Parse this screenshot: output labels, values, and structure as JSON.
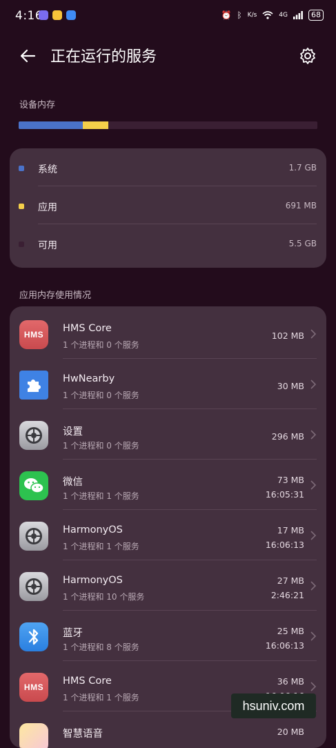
{
  "status_bar": {
    "time": "4:16",
    "net_speed": "K/s",
    "network": "4G",
    "battery": "68"
  },
  "header": {
    "title": "正在运行的服务"
  },
  "memory": {
    "section_label": "设备内存",
    "segments": [
      {
        "name": "系统",
        "fraction": 0.214,
        "color": "#4a72c9"
      },
      {
        "name": "应用",
        "fraction": 0.087,
        "color": "#f4cf4a"
      },
      {
        "name": "可用",
        "fraction": 0.699,
        "color": "#3a1f33"
      }
    ],
    "legend": [
      {
        "label": "系统",
        "value": "1.7 GB",
        "color": "#4a72c9"
      },
      {
        "label": "应用",
        "value": "691 MB",
        "color": "#f4cf4a"
      },
      {
        "label": "可用",
        "value": "5.5 GB",
        "color": "#3a1f33"
      }
    ]
  },
  "apps_section": {
    "label": "应用内存使用情况",
    "apps": [
      {
        "name": "HMS Core",
        "sub": "1 个进程和 0 个服务",
        "size": "102 MB",
        "time": "",
        "icon": "hms-icon"
      },
      {
        "name": "HwNearby",
        "sub": "1 个进程和 0 个服务",
        "size": "30 MB",
        "time": "",
        "icon": "puzzle-icon"
      },
      {
        "name": "设置",
        "sub": "1 个进程和 0 个服务",
        "size": "296 MB",
        "time": "",
        "icon": "settings-gear-icon"
      },
      {
        "name": "微信",
        "sub": "1 个进程和 1 个服务",
        "size": "73 MB",
        "time": "16:05:31",
        "icon": "wechat-icon"
      },
      {
        "name": "HarmonyOS",
        "sub": "1 个进程和 1 个服务",
        "size": "17 MB",
        "time": "16:06:13",
        "icon": "settings-gear-icon"
      },
      {
        "name": "HarmonyOS",
        "sub": "1 个进程和 10 个服务",
        "size": "27 MB",
        "time": "2:46:21",
        "icon": "settings-gear-icon"
      },
      {
        "name": "蓝牙",
        "sub": "1 个进程和 8 个服务",
        "size": "25 MB",
        "time": "16:06:13",
        "icon": "bluetooth-icon"
      },
      {
        "name": "HMS Core",
        "sub": "1 个进程和 1 个服务",
        "size": "36 MB",
        "time": "16:06:16",
        "icon": "hms-icon"
      },
      {
        "name": "智慧语音",
        "sub": "",
        "size": "20 MB",
        "time": "",
        "icon": "voice-assistant-icon"
      }
    ]
  },
  "hms_logo_text": "HMS",
  "watermark": "hsuniv.com"
}
